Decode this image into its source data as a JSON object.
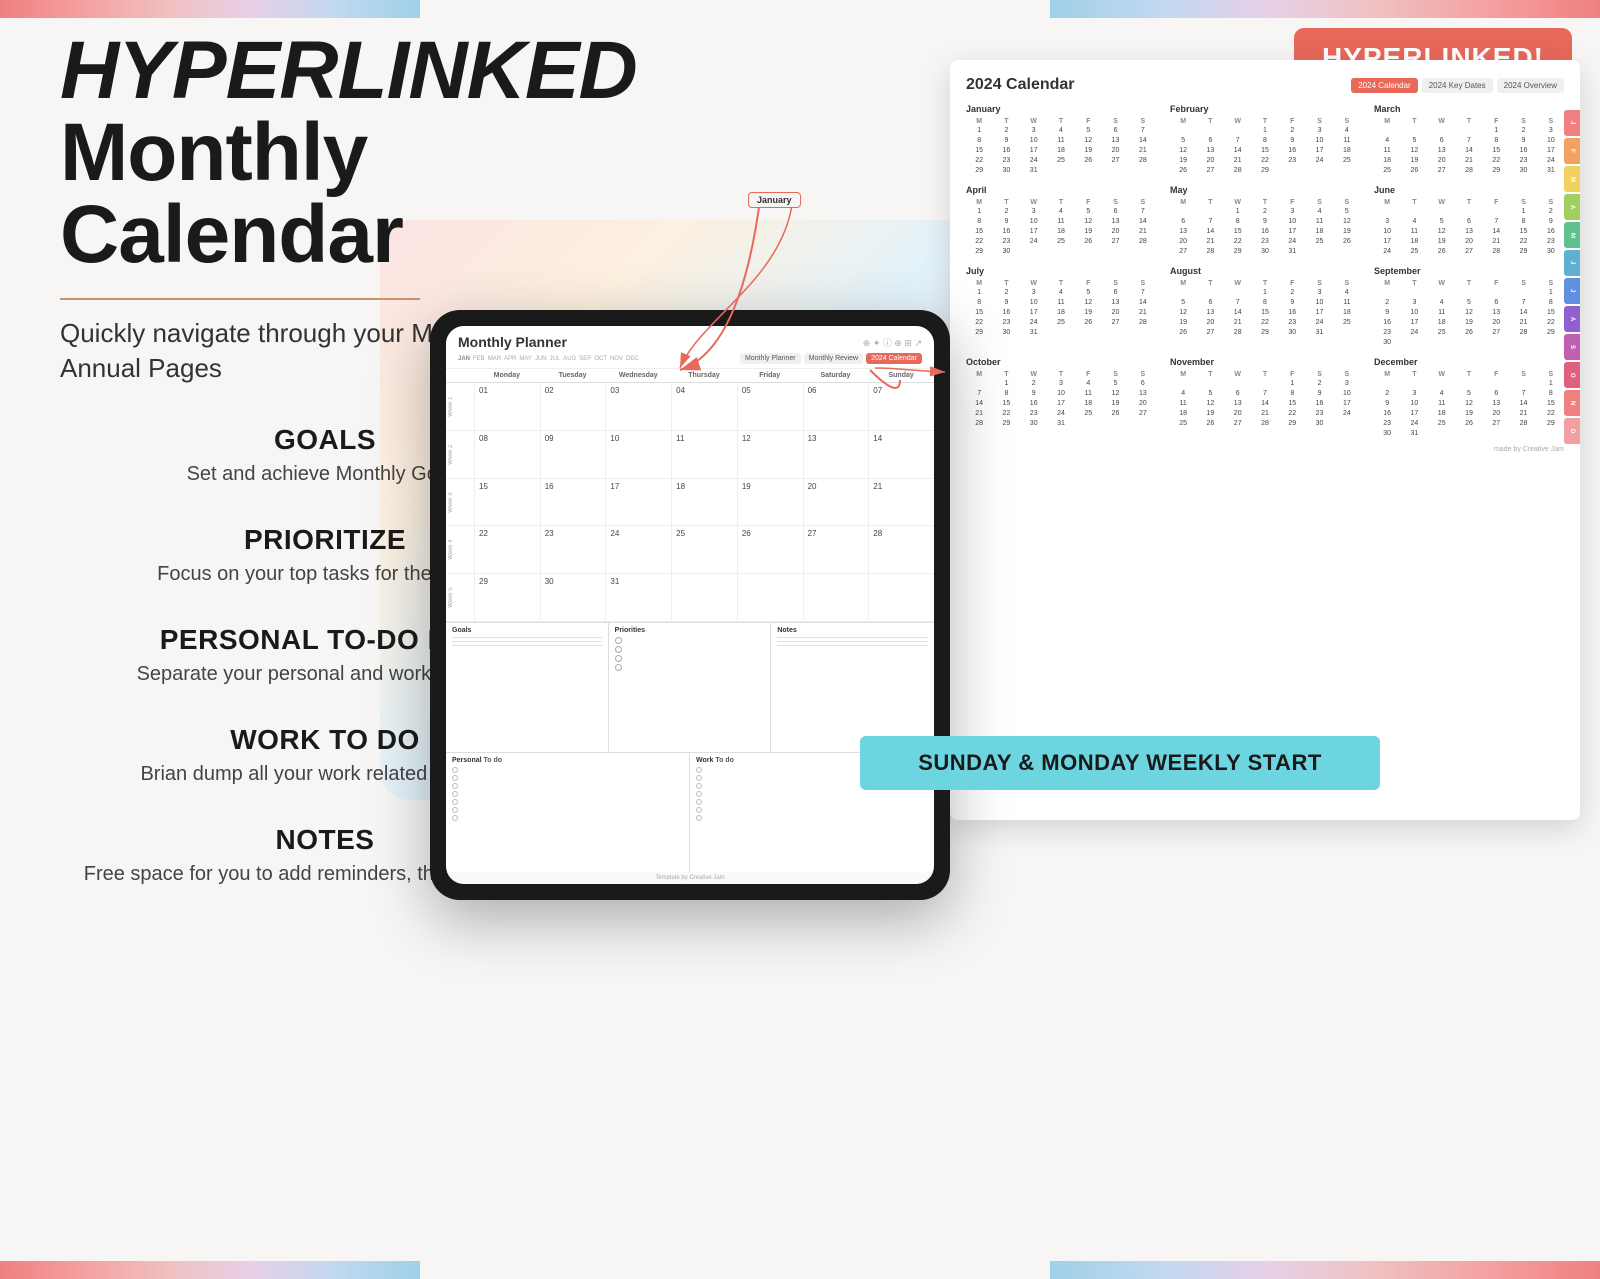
{
  "bg": {
    "stripes": [
      "#f08080",
      "#f4a0a0",
      "#f0c0c0",
      "#e8d0e8",
      "#c0d8f0",
      "#a0d0e8"
    ]
  },
  "badge": {
    "label": "HYPERLINKED!"
  },
  "main_title": {
    "line1": "HYPERLINKED",
    "line2": "Monthly Calendar"
  },
  "subtitle": "Quickly navigate through your Monthly and Annual Pages",
  "features": [
    {
      "title": "GOALS",
      "desc": "Set and achieve Monthly Goals"
    },
    {
      "title": "PRIORITIZE",
      "desc": "Focus on your top tasks for the month"
    },
    {
      "title": "PERSONAL TO-DO LIST",
      "desc": "Separate your personal and work task lists"
    },
    {
      "title": "WORK TO DO",
      "desc": "Brian dump all your work related task lists"
    },
    {
      "title": "NOTES",
      "desc": "Free space for you to add reminders, thoughts & ideas"
    }
  ],
  "tablet": {
    "title": "Monthly Planner",
    "months": [
      "JAN",
      "FEB",
      "MAR",
      "APR",
      "MAY",
      "JUN",
      "JUL",
      "AUG",
      "SEP",
      "OCT",
      "NOV",
      "DEC"
    ],
    "nav_buttons": [
      "Monthly Planner",
      "Monthly Review",
      "2024 Calendar"
    ],
    "day_headers": [
      "Monday",
      "Tuesday",
      "Wednesday",
      "Thursday",
      "Friday",
      "Saturday",
      "Sunday"
    ],
    "weeks": [
      {
        "label": "Week 1",
        "days": [
          "01",
          "02",
          "03",
          "04",
          "05",
          "06",
          "07"
        ]
      },
      {
        "label": "Week 2",
        "days": [
          "08",
          "09",
          "10",
          "11",
          "12",
          "13",
          "14"
        ]
      },
      {
        "label": "Week 3",
        "days": [
          "15",
          "16",
          "17",
          "18",
          "19",
          "20",
          "21"
        ]
      },
      {
        "label": "Week 4",
        "days": [
          "22",
          "23",
          "24",
          "25",
          "26",
          "27",
          "28"
        ]
      },
      {
        "label": "Week 5",
        "days": [
          "29",
          "30",
          "31",
          "",
          "",
          "",
          ""
        ]
      }
    ],
    "sections": {
      "goals": "Goals",
      "priorities": "Priorities",
      "notes": "Notes",
      "personal_todo": "Personal To do",
      "work_todo": "Work To do"
    },
    "footer": "Template by Creative Jam"
  },
  "annual": {
    "title": "2024 Calendar",
    "nav_buttons": [
      "2024 Calendar",
      "2024 Key Dates",
      "2024 Overview"
    ],
    "months": [
      {
        "name": "January",
        "days_header": [
          "M",
          "T",
          "W",
          "T",
          "F",
          "S",
          "S"
        ],
        "days": [
          "1",
          "2",
          "3",
          "4",
          "5",
          "6",
          "7",
          "8",
          "9",
          "10",
          "11",
          "12",
          "13",
          "14",
          "15",
          "16",
          "17",
          "18",
          "19",
          "20",
          "21",
          "22",
          "23",
          "24",
          "25",
          "26",
          "27",
          "28",
          "29",
          "30",
          "31"
        ]
      },
      {
        "name": "February",
        "days_header": [
          "M",
          "T",
          "W",
          "T",
          "F",
          "S",
          "S"
        ],
        "days": [
          "",
          "",
          "",
          "1",
          "2",
          "3",
          "4",
          "5",
          "6",
          "7",
          "8",
          "9",
          "10",
          "11",
          "12",
          "13",
          "14",
          "15",
          "16",
          "17",
          "18",
          "19",
          "20",
          "21",
          "22",
          "23",
          "24",
          "25",
          "26",
          "27",
          "28",
          "29"
        ]
      },
      {
        "name": "March",
        "days_header": [
          "M",
          "T",
          "W",
          "T",
          "F",
          "S",
          "S"
        ],
        "days": [
          "",
          "",
          "",
          "",
          "1",
          "2",
          "3",
          "4",
          "5",
          "6",
          "7",
          "8",
          "9",
          "10",
          "11",
          "12",
          "13",
          "14",
          "15",
          "16",
          "17",
          "18",
          "19",
          "20",
          "21",
          "22",
          "23",
          "24",
          "25",
          "26",
          "27",
          "28",
          "29",
          "30",
          "31"
        ]
      },
      {
        "name": "April",
        "days_header": [
          "M",
          "T",
          "W",
          "T",
          "F",
          "S",
          "S"
        ],
        "days": [
          "1",
          "2",
          "3",
          "4",
          "5",
          "6",
          "7",
          "8",
          "9",
          "10",
          "11",
          "12",
          "13",
          "14",
          "15",
          "16",
          "17",
          "18",
          "19",
          "20",
          "21",
          "22",
          "23",
          "24",
          "25",
          "26",
          "27",
          "28",
          "29",
          "30"
        ]
      },
      {
        "name": "May",
        "days_header": [
          "M",
          "T",
          "W",
          "T",
          "F",
          "S",
          "S"
        ],
        "days": [
          "",
          "",
          "1",
          "2",
          "3",
          "4",
          "5",
          "6",
          "7",
          "8",
          "9",
          "10",
          "11",
          "12",
          "13",
          "14",
          "15",
          "16",
          "17",
          "18",
          "19",
          "20",
          "21",
          "22",
          "23",
          "24",
          "25",
          "26",
          "27",
          "28",
          "29",
          "30",
          "31"
        ]
      },
      {
        "name": "June",
        "days_header": [
          "M",
          "T",
          "W",
          "T",
          "F",
          "S",
          "S"
        ],
        "days": [
          "",
          "",
          "",
          "",
          "",
          "1",
          "2",
          "3",
          "4",
          "5",
          "6",
          "7",
          "8",
          "9",
          "10",
          "11",
          "12",
          "13",
          "14",
          "15",
          "16",
          "17",
          "18",
          "19",
          "20",
          "21",
          "22",
          "23",
          "24",
          "25",
          "26",
          "27",
          "28",
          "29",
          "30"
        ]
      },
      {
        "name": "July",
        "days_header": [
          "M",
          "T",
          "W",
          "T",
          "F",
          "S",
          "S"
        ],
        "days": [
          "1",
          "2",
          "3",
          "4",
          "5",
          "6",
          "7",
          "8",
          "9",
          "10",
          "11",
          "12",
          "13",
          "14",
          "15",
          "16",
          "17",
          "18",
          "19",
          "20",
          "21",
          "22",
          "23",
          "24",
          "25",
          "26",
          "27",
          "28",
          "29",
          "30",
          "31"
        ]
      },
      {
        "name": "August",
        "days_header": [
          "M",
          "T",
          "W",
          "T",
          "F",
          "S",
          "S"
        ],
        "days": [
          "",
          "",
          "",
          "1",
          "2",
          "3",
          "4",
          "5",
          "6",
          "7",
          "8",
          "9",
          "10",
          "11",
          "12",
          "13",
          "14",
          "15",
          "16",
          "17",
          "18",
          "19",
          "20",
          "21",
          "22",
          "23",
          "24",
          "25",
          "26",
          "27",
          "28",
          "29",
          "30",
          "31"
        ]
      },
      {
        "name": "September",
        "days_header": [
          "M",
          "T",
          "W",
          "T",
          "F",
          "S",
          "S"
        ],
        "days": [
          "",
          "",
          "",
          "",
          "",
          "",
          "1",
          "2",
          "3",
          "4",
          "5",
          "6",
          "7",
          "8",
          "9",
          "10",
          "11",
          "12",
          "13",
          "14",
          "15",
          "16",
          "17",
          "18",
          "19",
          "20",
          "21",
          "22",
          "23",
          "24",
          "25",
          "26",
          "27",
          "28",
          "29",
          "30"
        ]
      },
      {
        "name": "October",
        "days_header": [
          "M",
          "T",
          "W",
          "T",
          "F",
          "S",
          "S"
        ],
        "days": [
          "",
          "1",
          "2",
          "3",
          "4",
          "5",
          "6",
          "7",
          "8",
          "9",
          "10",
          "11",
          "12",
          "13",
          "14",
          "15",
          "16",
          "17",
          "18",
          "19",
          "20",
          "21",
          "22",
          "23",
          "24",
          "25",
          "26",
          "27",
          "28",
          "29",
          "30",
          "31"
        ]
      },
      {
        "name": "November",
        "days_header": [
          "M",
          "T",
          "W",
          "T",
          "F",
          "S",
          "S"
        ],
        "days": [
          "",
          "",
          "",
          "",
          "1",
          "2",
          "3",
          "4",
          "5",
          "6",
          "7",
          "8",
          "9",
          "10",
          "11",
          "12",
          "13",
          "14",
          "15",
          "16",
          "17",
          "18",
          "19",
          "20",
          "21",
          "22",
          "23",
          "24",
          "25",
          "26",
          "27",
          "28",
          "29",
          "30"
        ]
      },
      {
        "name": "December",
        "days_header": [
          "M",
          "T",
          "W",
          "T",
          "F",
          "S",
          "S"
        ],
        "days": [
          "",
          "",
          "",
          "",
          "",
          "",
          "1",
          "2",
          "3",
          "4",
          "5",
          "6",
          "7",
          "8",
          "9",
          "10",
          "11",
          "12",
          "13",
          "14",
          "15",
          "16",
          "17",
          "18",
          "19",
          "20",
          "21",
          "22",
          "23",
          "24",
          "25",
          "26",
          "27",
          "28",
          "29",
          "30",
          "31"
        ]
      }
    ]
  },
  "bottom_banner": "SUNDAY & MONDAY WEEKLY START"
}
